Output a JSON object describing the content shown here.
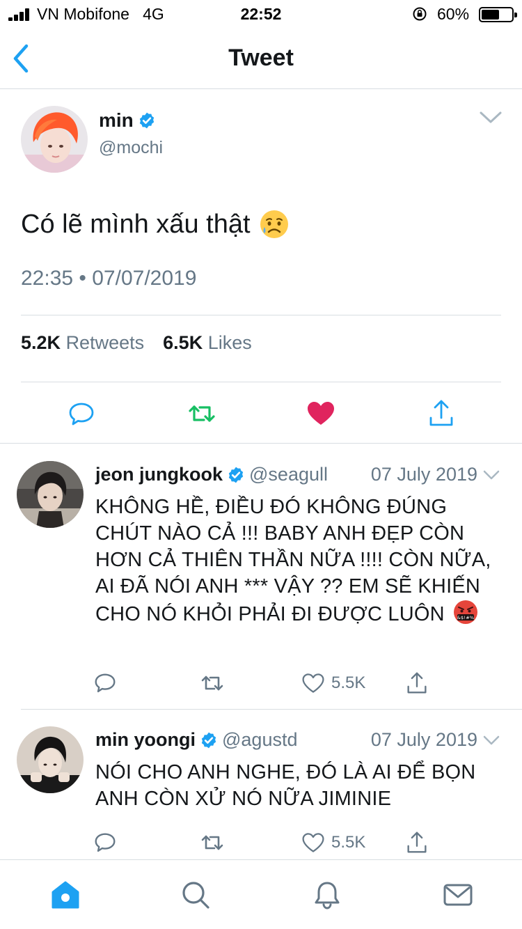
{
  "status_bar": {
    "carrier": "VN Mobifone",
    "network": "4G",
    "time": "22:52",
    "battery_percent": "60%",
    "battery_level": 0.6
  },
  "nav": {
    "title": "Tweet",
    "back_icon": "chevron-left-icon"
  },
  "tweet": {
    "author_name": "min",
    "author_handle": "@mochi",
    "verified": true,
    "text": "Có lẽ mình xấu thật",
    "emoji": "sad-sweat-face-emoji",
    "timestamp": "22:35 • 07/07/2019",
    "retweets_count": "5.2K",
    "retweets_label": "Retweets",
    "likes_count": "6.5K",
    "likes_label": "Likes",
    "liked": true,
    "retweeted": true
  },
  "replies": [
    {
      "name": "jeon jungkook",
      "handle": "@seagull",
      "date": "07 July 2019",
      "verified": true,
      "text": "KHÔNG HỀ, ĐIỀU ĐÓ KHÔNG ĐÚNG CHÚT NÀO CẢ !!! BABY ANH ĐẸP CÒN HƠN CẢ THIÊN THẦN NỮA !!!! CÒN NỮA, AI ĐÃ NÓI ANH *** VẬY ?? EM SẼ KHIẾN CHO NÓ KHỎI PHẢI ĐI ĐƯỢC LUÔN",
      "emoji": "angry-cursing-face-emoji",
      "likes": "5.5K"
    },
    {
      "name": "min yoongi",
      "handle": "@agustd",
      "date": "07 July 2019",
      "verified": true,
      "text": "NÓI CHO ANH NGHE, ĐÓ LÀ AI ĐỂ BỌN ANH CÒN XỬ NÓ NỮA JIMINIE",
      "likes": "5.5K"
    }
  ],
  "tabbar": {
    "items": [
      "home-icon",
      "search-icon",
      "bell-icon",
      "mail-icon"
    ],
    "active": "home-icon"
  },
  "colors": {
    "accent": "#1da1f2",
    "retweet_green": "#17bf63",
    "like_red": "#e0245e",
    "secondary_text": "#657786",
    "divider": "#d8dde1"
  }
}
